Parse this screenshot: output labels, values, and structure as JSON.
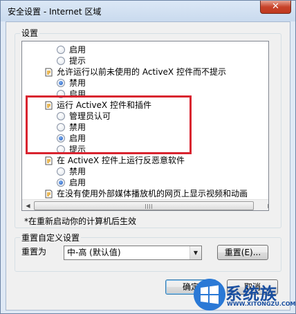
{
  "window": {
    "title": "安全设置 - Internet 区域",
    "close_label": "✕"
  },
  "settings": {
    "group_label": "设置",
    "items": [
      {
        "type": "radio",
        "label": "启用",
        "checked": false
      },
      {
        "type": "radio",
        "label": "提示",
        "checked": false
      },
      {
        "type": "header",
        "label": "允许运行以前未使用的 ActiveX 控件而不提示"
      },
      {
        "type": "radio",
        "label": "禁用",
        "checked": true
      },
      {
        "type": "radio",
        "label": "启用",
        "checked": false
      },
      {
        "type": "header",
        "label": "运行 ActiveX 控件和插件"
      },
      {
        "type": "radio",
        "label": "管理员认可",
        "checked": false
      },
      {
        "type": "radio",
        "label": "禁用",
        "checked": false
      },
      {
        "type": "radio",
        "label": "启用",
        "checked": true
      },
      {
        "type": "radio",
        "label": "提示",
        "checked": false
      },
      {
        "type": "header",
        "label": "在 ActiveX 控件上运行反恶意软件"
      },
      {
        "type": "radio",
        "label": "禁用",
        "checked": false
      },
      {
        "type": "radio",
        "label": "启用",
        "checked": true
      },
      {
        "type": "header",
        "label": "在没有使用外部媒体播放机的网页上显示视频和动画"
      },
      {
        "type": "radio",
        "label": "禁用",
        "checked": false
      }
    ],
    "restart_note": "*在重新启动你的计算机后生效",
    "scroll_up": "▲",
    "scroll_down": "▼",
    "scroll_left": "◀",
    "scroll_right": "▶"
  },
  "reset": {
    "group_label": "重置自定义设置",
    "reset_to_label": "重置为",
    "level_value": "中-高 (默认值)",
    "reset_button": "重置(E)..."
  },
  "footer": {
    "ok_button": "确定",
    "cancel_button": "取消"
  },
  "watermark": {
    "brand": "系统族",
    "url": "WWW.XITONGZU.COM"
  }
}
